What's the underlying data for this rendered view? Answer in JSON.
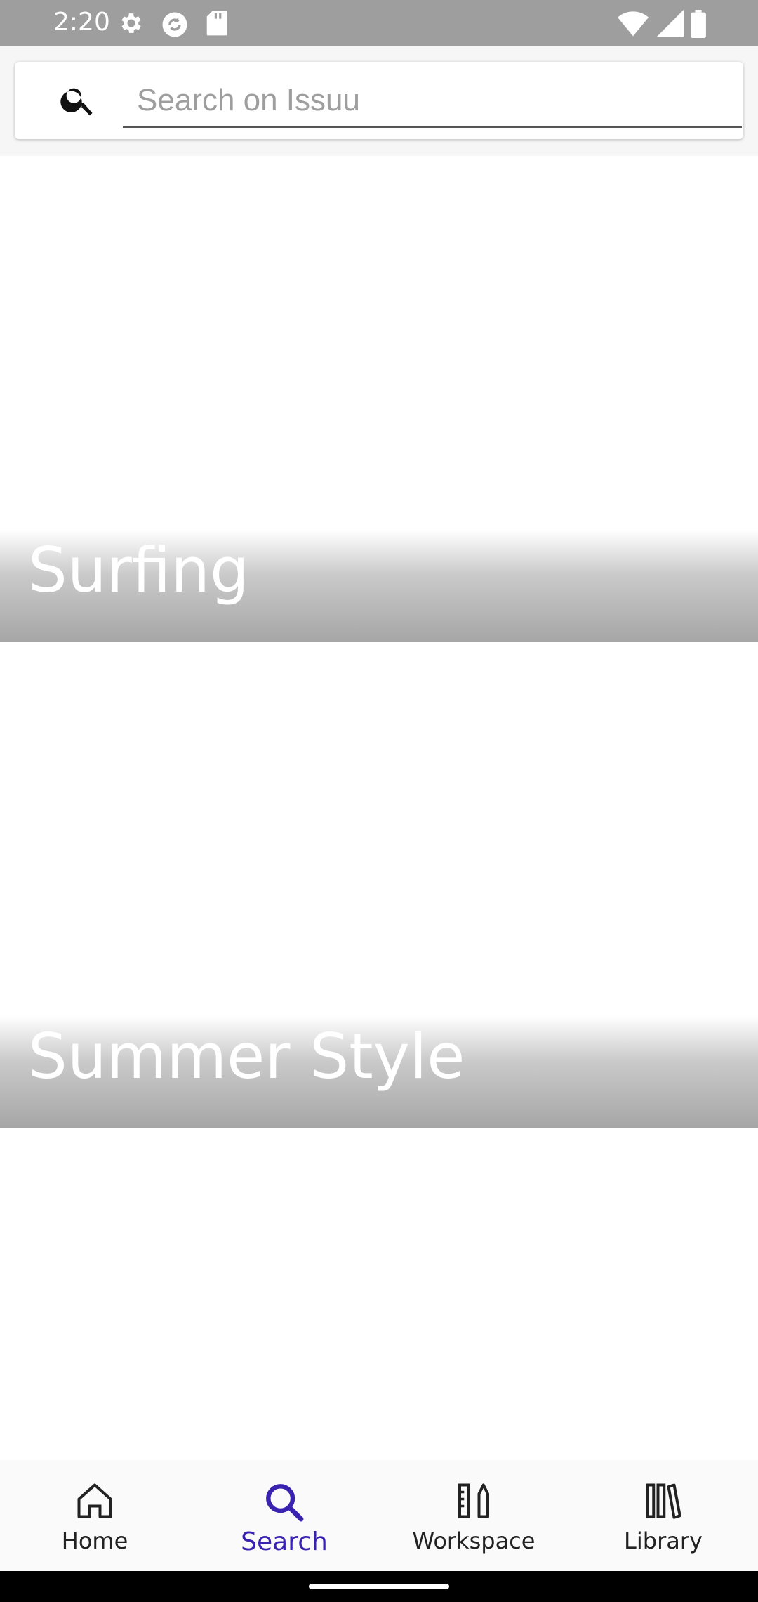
{
  "status_bar": {
    "time": "2:20",
    "icons": [
      "gear-icon",
      "sync-icon",
      "sd-card-icon",
      "wifi-icon",
      "signal-icon",
      "battery-icon"
    ]
  },
  "search": {
    "placeholder": "Search on Issuu",
    "value": "",
    "icon": "search-icon"
  },
  "topics": [
    {
      "label": "Surfing"
    },
    {
      "label": "Summer Style"
    }
  ],
  "bottom_nav": {
    "active": "Search",
    "accent_color": "#3a22b0",
    "items": [
      {
        "label": "Home",
        "icon": "home-icon"
      },
      {
        "label": "Search",
        "icon": "search-icon"
      },
      {
        "label": "Workspace",
        "icon": "workspace-icon"
      },
      {
        "label": "Library",
        "icon": "library-icon"
      }
    ]
  }
}
